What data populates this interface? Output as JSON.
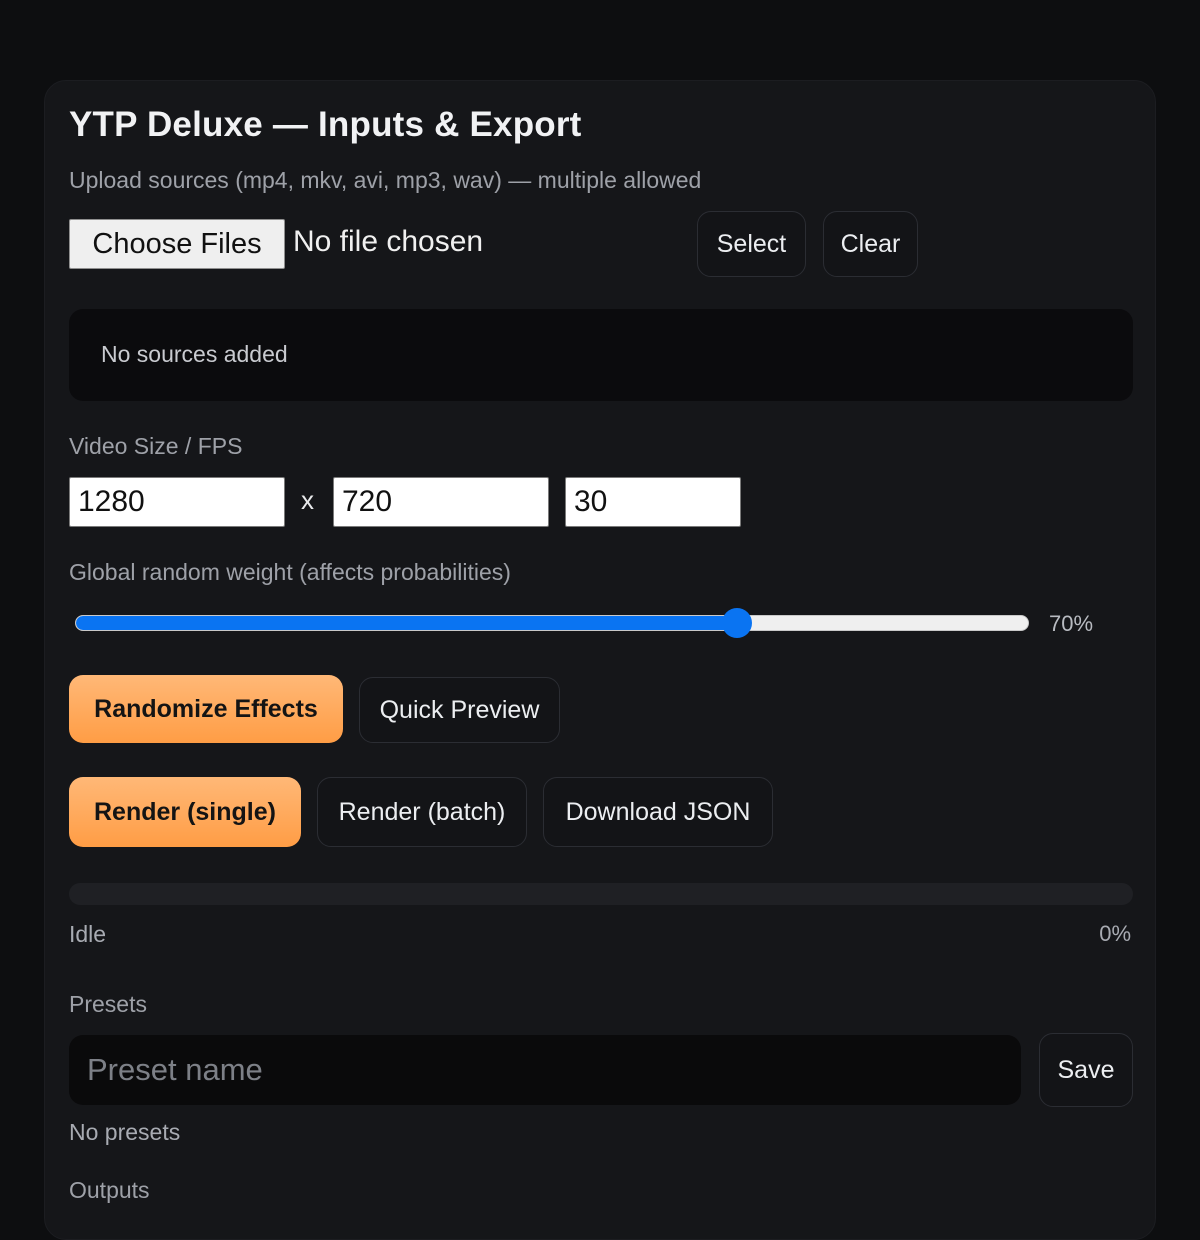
{
  "panel": {
    "title": "YTP Deluxe — Inputs & Export",
    "upload_label": "Upload sources (mp4, mkv, avi, mp3, wav) — multiple allowed",
    "choose_files_label": "Choose Files",
    "file_status": "No file chosen",
    "select_label": "Select",
    "clear_label": "Clear",
    "sources_empty": "No sources added"
  },
  "video": {
    "label": "Video Size / FPS",
    "width": "1280",
    "separator": "x",
    "height": "720",
    "fps": "30"
  },
  "weight": {
    "label": "Global random weight (affects probabilities)",
    "value": 70,
    "value_text": "70%"
  },
  "actions": {
    "randomize_label": "Randomize Effects",
    "preview_label": "Quick Preview",
    "render_single_label": "Render (single)",
    "render_batch_label": "Render (batch)",
    "download_json_label": "Download JSON"
  },
  "progress": {
    "value": 0,
    "status": "Idle",
    "percent_text": "0%"
  },
  "presets": {
    "label": "Presets",
    "placeholder": "Preset name",
    "save_label": "Save",
    "empty": "No presets"
  },
  "outputs": {
    "label": "Outputs"
  },
  "colors": {
    "accent": "#ff9d45",
    "slider": "#0a74f2",
    "background": "#0d0e10",
    "card": "#151619"
  }
}
